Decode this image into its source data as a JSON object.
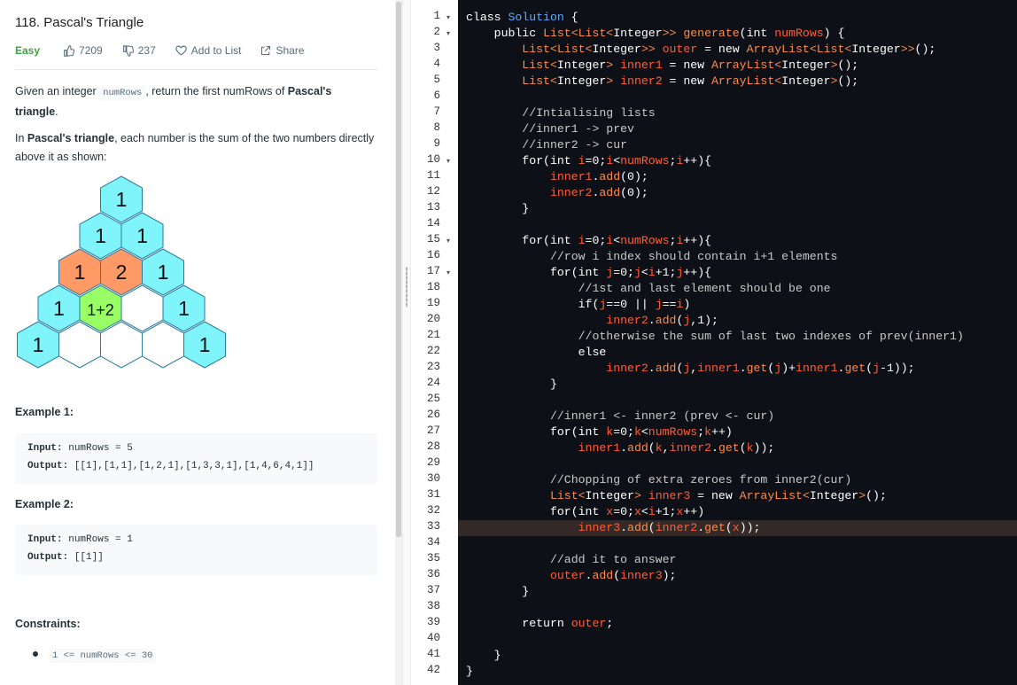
{
  "problem": {
    "title": "118. Pascal's Triangle",
    "difficulty": "Easy",
    "likes": "7209",
    "dislikes": "237",
    "add_to_list": "Add to List",
    "share": "Share",
    "desc1_pre": "Given an integer ",
    "desc1_code": "numRows",
    "desc1_mid": ", return the first numRows of ",
    "desc1_bold": "Pascal's triangle",
    "desc1_end": ".",
    "desc2_pre": "In ",
    "desc2_bold": "Pascal's triangle",
    "desc2_post": ", each number is the sum of the two numbers directly above it as shown:",
    "triangle_labels": [
      "1",
      "1",
      "1",
      "1",
      "2",
      "1",
      "1",
      "1+2",
      "1",
      "1",
      "1"
    ],
    "triangle_colors": {
      "cyan": "#7ff4fb",
      "orange": "#ff9966",
      "green": "#99ff66",
      "empty": "#ffffff",
      "stroke": "#2b7a9b"
    }
  },
  "examples": [
    {
      "title": "Example 1:",
      "input_label": "Input:",
      "input_value": "numRows = 5",
      "output_label": "Output:",
      "output_value": "[[1],[1,1],[1,2,1],[1,3,3,1],[1,4,6,4,1]]"
    },
    {
      "title": "Example 2:",
      "input_label": "Input:",
      "input_value": "numRows = 1",
      "output_label": "Output:",
      "output_value": "[[1]]"
    }
  ],
  "constraints": {
    "title": "Constraints:",
    "items": [
      "1 <= numRows <= 30"
    ]
  },
  "editor": {
    "highlighted_line": 33,
    "fold_lines": [
      1,
      2,
      10,
      15,
      17
    ],
    "code": [
      [
        [
          "kw",
          "class "
        ],
        [
          "cls",
          "Solution"
        ],
        [
          "kw",
          " {"
        ]
      ],
      [
        [
          "kw",
          "    public "
        ],
        [
          "ty",
          "List<List<"
        ],
        [
          "kw",
          "Integer"
        ],
        [
          "ty",
          ">> "
        ],
        [
          "fn",
          "generate"
        ],
        [
          "kw",
          "(int "
        ],
        [
          "id",
          "numRows"
        ],
        [
          "kw",
          ") {"
        ]
      ],
      [
        [
          "ty",
          "        List<List<"
        ],
        [
          "kw",
          "Integer"
        ],
        [
          "ty",
          ">> "
        ],
        [
          "id",
          "outer"
        ],
        [
          "kw",
          " = new "
        ],
        [
          "ty",
          "ArrayList<List<"
        ],
        [
          "kw",
          "Integer"
        ],
        [
          "ty",
          ">>"
        ],
        [
          "kw",
          "();"
        ]
      ],
      [
        [
          "ty",
          "        List<"
        ],
        [
          "kw",
          "Integer"
        ],
        [
          "ty",
          "> "
        ],
        [
          "id",
          "inner1"
        ],
        [
          "kw",
          " = new "
        ],
        [
          "ty",
          "ArrayList<"
        ],
        [
          "kw",
          "Integer"
        ],
        [
          "ty",
          ">"
        ],
        [
          "kw",
          "();"
        ]
      ],
      [
        [
          "ty",
          "        List<"
        ],
        [
          "kw",
          "Integer"
        ],
        [
          "ty",
          "> "
        ],
        [
          "id",
          "inner2"
        ],
        [
          "kw",
          " = new "
        ],
        [
          "ty",
          "ArrayList<"
        ],
        [
          "kw",
          "Integer"
        ],
        [
          "ty",
          ">"
        ],
        [
          "kw",
          "();"
        ]
      ],
      [],
      [
        [
          "cm",
          "        //Intialising lists"
        ]
      ],
      [
        [
          "cm",
          "        //inner1 -> prev"
        ]
      ],
      [
        [
          "cm",
          "        //inner2 -> cur"
        ]
      ],
      [
        [
          "kw",
          "        for(int "
        ],
        [
          "id",
          "i"
        ],
        [
          "kw",
          "=0;"
        ],
        [
          "id",
          "i"
        ],
        [
          "kw",
          "<"
        ],
        [
          "id",
          "numRows"
        ],
        [
          "kw",
          ";"
        ],
        [
          "id",
          "i"
        ],
        [
          "kw",
          "++){"
        ]
      ],
      [
        [
          "id",
          "            inner1"
        ],
        [
          "kw",
          "."
        ],
        [
          "fn",
          "add"
        ],
        [
          "kw",
          "(0);"
        ]
      ],
      [
        [
          "id",
          "            inner2"
        ],
        [
          "kw",
          "."
        ],
        [
          "fn",
          "add"
        ],
        [
          "kw",
          "(0);"
        ]
      ],
      [
        [
          "kw",
          "        }"
        ]
      ],
      [],
      [
        [
          "kw",
          "        for(int "
        ],
        [
          "id",
          "i"
        ],
        [
          "kw",
          "=0;"
        ],
        [
          "id",
          "i"
        ],
        [
          "kw",
          "<"
        ],
        [
          "id",
          "numRows"
        ],
        [
          "kw",
          ";"
        ],
        [
          "id",
          "i"
        ],
        [
          "kw",
          "++){"
        ]
      ],
      [
        [
          "cm",
          "            //row i index should contain i+1 elements"
        ]
      ],
      [
        [
          "kw",
          "            for(int "
        ],
        [
          "id",
          "j"
        ],
        [
          "kw",
          "=0;"
        ],
        [
          "id",
          "j"
        ],
        [
          "kw",
          "<"
        ],
        [
          "id",
          "i"
        ],
        [
          "kw",
          "+1;"
        ],
        [
          "id",
          "j"
        ],
        [
          "kw",
          "++){"
        ]
      ],
      [
        [
          "cm",
          "                //1st and last element should be one"
        ]
      ],
      [
        [
          "kw",
          "                if("
        ],
        [
          "id",
          "j"
        ],
        [
          "kw",
          "==0 || "
        ],
        [
          "id",
          "j"
        ],
        [
          "kw",
          "=="
        ],
        [
          "id",
          "i"
        ],
        [
          "kw",
          ")"
        ]
      ],
      [
        [
          "id",
          "                    inner2"
        ],
        [
          "kw",
          "."
        ],
        [
          "fn",
          "add"
        ],
        [
          "kw",
          "("
        ],
        [
          "id",
          "j"
        ],
        [
          "kw",
          ",1);"
        ]
      ],
      [
        [
          "cm",
          "                //otherwise the sum of last two indexes of prev(inner1)"
        ]
      ],
      [
        [
          "kw",
          "                else"
        ]
      ],
      [
        [
          "id",
          "                    inner2"
        ],
        [
          "kw",
          "."
        ],
        [
          "fn",
          "add"
        ],
        [
          "kw",
          "("
        ],
        [
          "id",
          "j"
        ],
        [
          "kw",
          ","
        ],
        [
          "id",
          "inner1"
        ],
        [
          "kw",
          "."
        ],
        [
          "fn",
          "get"
        ],
        [
          "kw",
          "("
        ],
        [
          "id",
          "j"
        ],
        [
          "kw",
          ")+"
        ],
        [
          "id",
          "inner1"
        ],
        [
          "kw",
          "."
        ],
        [
          "fn",
          "get"
        ],
        [
          "kw",
          "("
        ],
        [
          "id",
          "j"
        ],
        [
          "kw",
          "-1));"
        ]
      ],
      [
        [
          "kw",
          "            }"
        ]
      ],
      [],
      [
        [
          "cm",
          "            //inner1 <- inner2 (prev <- cur)"
        ]
      ],
      [
        [
          "kw",
          "            for(int "
        ],
        [
          "id",
          "k"
        ],
        [
          "kw",
          "=0;"
        ],
        [
          "id",
          "k"
        ],
        [
          "kw",
          "<"
        ],
        [
          "id",
          "numRows"
        ],
        [
          "kw",
          ";"
        ],
        [
          "id",
          "k"
        ],
        [
          "kw",
          "++)"
        ]
      ],
      [
        [
          "id",
          "                inner1"
        ],
        [
          "kw",
          "."
        ],
        [
          "fn",
          "add"
        ],
        [
          "kw",
          "("
        ],
        [
          "id",
          "k"
        ],
        [
          "kw",
          ","
        ],
        [
          "id",
          "inner2"
        ],
        [
          "kw",
          "."
        ],
        [
          "fn",
          "get"
        ],
        [
          "kw",
          "("
        ],
        [
          "id",
          "k"
        ],
        [
          "kw",
          "));"
        ]
      ],
      [],
      [
        [
          "cm",
          "            //Chopping of extra zeroes from inner2(cur)"
        ]
      ],
      [
        [
          "ty",
          "            List<"
        ],
        [
          "kw",
          "Integer"
        ],
        [
          "ty",
          "> "
        ],
        [
          "id",
          "inner3"
        ],
        [
          "kw",
          " = new "
        ],
        [
          "ty",
          "ArrayList<"
        ],
        [
          "kw",
          "Integer"
        ],
        [
          "ty",
          ">"
        ],
        [
          "kw",
          "();"
        ]
      ],
      [
        [
          "kw",
          "            for(int "
        ],
        [
          "id",
          "x"
        ],
        [
          "kw",
          "=0;"
        ],
        [
          "id",
          "x"
        ],
        [
          "kw",
          "<"
        ],
        [
          "id",
          "i"
        ],
        [
          "kw",
          "+1;"
        ],
        [
          "id",
          "x"
        ],
        [
          "kw",
          "++)"
        ]
      ],
      [
        [
          "id",
          "                inner3"
        ],
        [
          "kw",
          "."
        ],
        [
          "fn",
          "add"
        ],
        [
          "kw",
          "("
        ],
        [
          "id",
          "inner2"
        ],
        [
          "kw",
          "."
        ],
        [
          "fn",
          "get"
        ],
        [
          "kw",
          "("
        ],
        [
          "id",
          "x"
        ],
        [
          "kw",
          "));"
        ]
      ],
      [],
      [
        [
          "cm",
          "            //add it to answer"
        ]
      ],
      [
        [
          "id",
          "            outer"
        ],
        [
          "kw",
          "."
        ],
        [
          "fn",
          "add"
        ],
        [
          "kw",
          "("
        ],
        [
          "id",
          "inner3"
        ],
        [
          "kw",
          ");"
        ]
      ],
      [
        [
          "kw",
          "        }"
        ]
      ],
      [],
      [
        [
          "kw",
          "        return "
        ],
        [
          "id",
          "outer"
        ],
        [
          "kw",
          ";"
        ]
      ],
      [],
      [
        [
          "kw",
          "    }"
        ]
      ],
      [
        [
          "kw",
          "}"
        ]
      ]
    ]
  }
}
